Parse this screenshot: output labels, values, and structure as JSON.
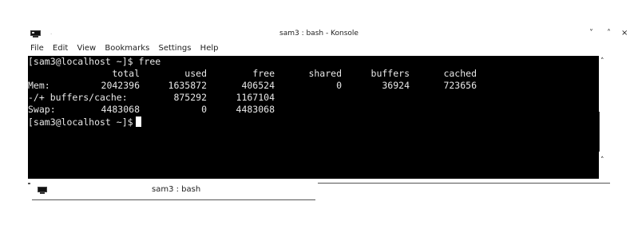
{
  "window": {
    "title": "sam3 : bash - Konsole",
    "dot": "·",
    "buttons": {
      "minimize": "˅",
      "maximize": "˄",
      "close": "×"
    }
  },
  "menubar": {
    "items": [
      {
        "label": "File"
      },
      {
        "label": "Edit"
      },
      {
        "label": "View"
      },
      {
        "label": "Bookmarks"
      },
      {
        "label": "Settings"
      },
      {
        "label": "Help"
      }
    ]
  },
  "terminal": {
    "command_line": "[sam3@localhost ~]$ free",
    "header": {
      "total": "total",
      "used": "used",
      "free": "free",
      "shared": "shared",
      "buffers": "buffers",
      "cached": "cached"
    },
    "mem": {
      "label": "Mem:",
      "total": "2042396",
      "used": "1635872",
      "free": "406524",
      "shared": "0",
      "buffers": "36924",
      "cached": "723656"
    },
    "buffers_cache": {
      "label": "-/+ buffers/cache:",
      "used": "875292",
      "free": "1167104"
    },
    "swap": {
      "label": "Swap:",
      "total": "4483068",
      "used": "0",
      "free": "4483068"
    },
    "prompt": "[sam3@localhost ~]$"
  },
  "scrollbar": {
    "up": "˄",
    "down": "˄"
  },
  "tab": {
    "label": "sam3 : bash"
  }
}
